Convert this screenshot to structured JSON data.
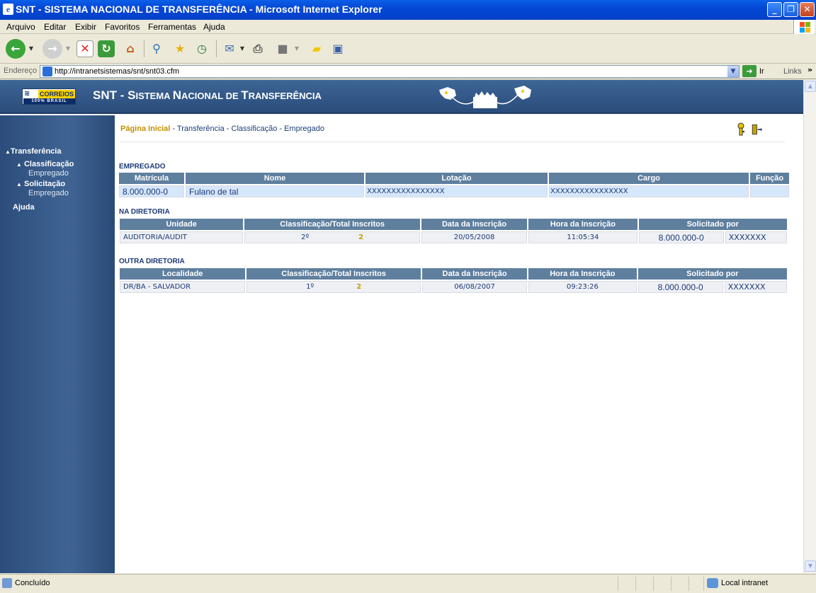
{
  "window": {
    "title": "SNT - SISTEMA NACIONAL DE TRANSFERÊNCIA - Microsoft Internet Explorer",
    "minimize": "_",
    "restore": "❐",
    "close": "✕"
  },
  "menu": [
    "Arquivo",
    "Editar",
    "Exibir",
    "Favoritos",
    "Ferramentas",
    "Ajuda"
  ],
  "address": {
    "label": "Endereço",
    "url": "http://intranetsistemas/snt/snt03.cfm",
    "go_label": "Ir",
    "links_label": "Links"
  },
  "banner": {
    "logo_top": "CORREIOS",
    "logo_bottom": "100% BRASIL",
    "system_prefix": "SNT - S",
    "system_name_html": "ISTEMA ",
    "title_parts": [
      "SNT - ",
      "S",
      "ISTEMA ",
      "N",
      "ACIONAL DE ",
      "T",
      "RANSFERÊNCIA"
    ]
  },
  "sidebar": {
    "items": [
      {
        "label": "Transferência",
        "arrow": "▲"
      },
      {
        "label": "Classificação",
        "arrow": "▲"
      },
      {
        "label": "Empregado"
      },
      {
        "label": "Solicitação",
        "arrow": "▲"
      },
      {
        "label": "Empregado"
      },
      {
        "label": "Ajuda"
      }
    ]
  },
  "breadcrumb": {
    "home": "Página Inicial",
    "rest": " - Transferência - Classificação - Empregado"
  },
  "empregado": {
    "section": "EMPREGADO",
    "headers": [
      "Matrícula",
      "Nome",
      "Lotação",
      "Cargo",
      "Função"
    ],
    "row": [
      "8.000.000-0",
      "Fulano de tal",
      "XXXXXXXXXXXXXXXX",
      "XXXXXXXXXXXXXXXX",
      ""
    ]
  },
  "na_diretoria": {
    "section": "NA DIRETORIA",
    "headers": [
      "Unidade",
      "Classificação/Total Inscritos",
      "Data da Inscrição",
      "Hora da Inscrição",
      "Solicitado por"
    ],
    "row": {
      "unidade": "AUDITORIA/AUDIT",
      "classificacao": "2º",
      "total": "2",
      "data": "20/05/2008",
      "hora": "11:05:34",
      "solicitado_mat": "8.000.000-0",
      "solicitado_nome": "XXXXXXX"
    }
  },
  "outra_diretoria": {
    "section": "OUTRA DIRETORIA",
    "headers": [
      "Localidade",
      "Classificação/Total Inscritos",
      "Data da Inscrição",
      "Hora da Inscrição",
      "Solicitado por"
    ],
    "row": {
      "localidade": "DR/BA - SALVADOR",
      "classificacao": "1º",
      "total": "2",
      "data": "06/08/2007",
      "hora": "09:23:26",
      "solicitado_mat": "8.000.000-0",
      "solicitado_nome": "XXXXXXX"
    }
  },
  "status": {
    "text": "Concluído",
    "zone": "Local intranet"
  }
}
